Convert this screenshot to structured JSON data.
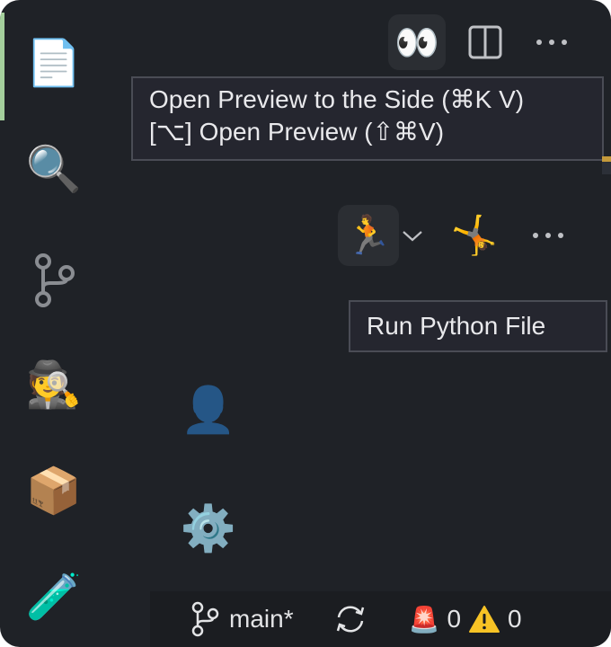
{
  "activity_bar": {
    "items": [
      {
        "id": "explorer",
        "icon": "documents-icon",
        "glyph": "📄",
        "active": true
      },
      {
        "id": "search",
        "icon": "magnifier-icon",
        "glyph": "🔍"
      },
      {
        "id": "source-control",
        "icon": "source-control-icon"
      },
      {
        "id": "remote-explorer",
        "icon": "detective-icon",
        "glyph": "🕵️"
      },
      {
        "id": "extensions",
        "icon": "package-icon",
        "glyph": "📦"
      },
      {
        "id": "testing",
        "icon": "test-tube-icon",
        "glyph": "🧪"
      }
    ],
    "accounts": {
      "icon": "bust-silhouette-icon",
      "glyph": "👤"
    },
    "manage": {
      "icon": "gear-icon",
      "glyph": "⚙️"
    },
    "active_indicator_color": "#a4cf9c"
  },
  "editor_toolbar": {
    "preview_button": {
      "icon": "eyes-icon",
      "glyph": "👀"
    },
    "split_editor_button": {
      "icon": "split-editor-icon"
    },
    "more_actions": {
      "icon": "more-icon"
    }
  },
  "preview_tooltip": {
    "line1": "Open Preview to the Side (⌘K V)",
    "line2": "[⌥] Open Preview (⇧⌘V)"
  },
  "run_toolbar": {
    "run_button": {
      "icon": "runner-icon",
      "glyph": "🏃"
    },
    "dropdown": {
      "icon": "chevron-down-icon"
    },
    "debug_button": {
      "icon": "cartwheel-icon",
      "glyph": "🤸"
    },
    "more_actions": {
      "icon": "more-icon"
    }
  },
  "run_tooltip": {
    "text": "Run Python File"
  },
  "status_bar": {
    "branch_icon": "git-branch-icon",
    "branch": "main*",
    "sync_icon": "sync-icon",
    "errors_icon": "siren-icon",
    "errors_glyph": "🚨",
    "errors": "0",
    "warnings_icon": "warning-icon",
    "warnings_glyph": "⚠️",
    "warnings": "0"
  }
}
